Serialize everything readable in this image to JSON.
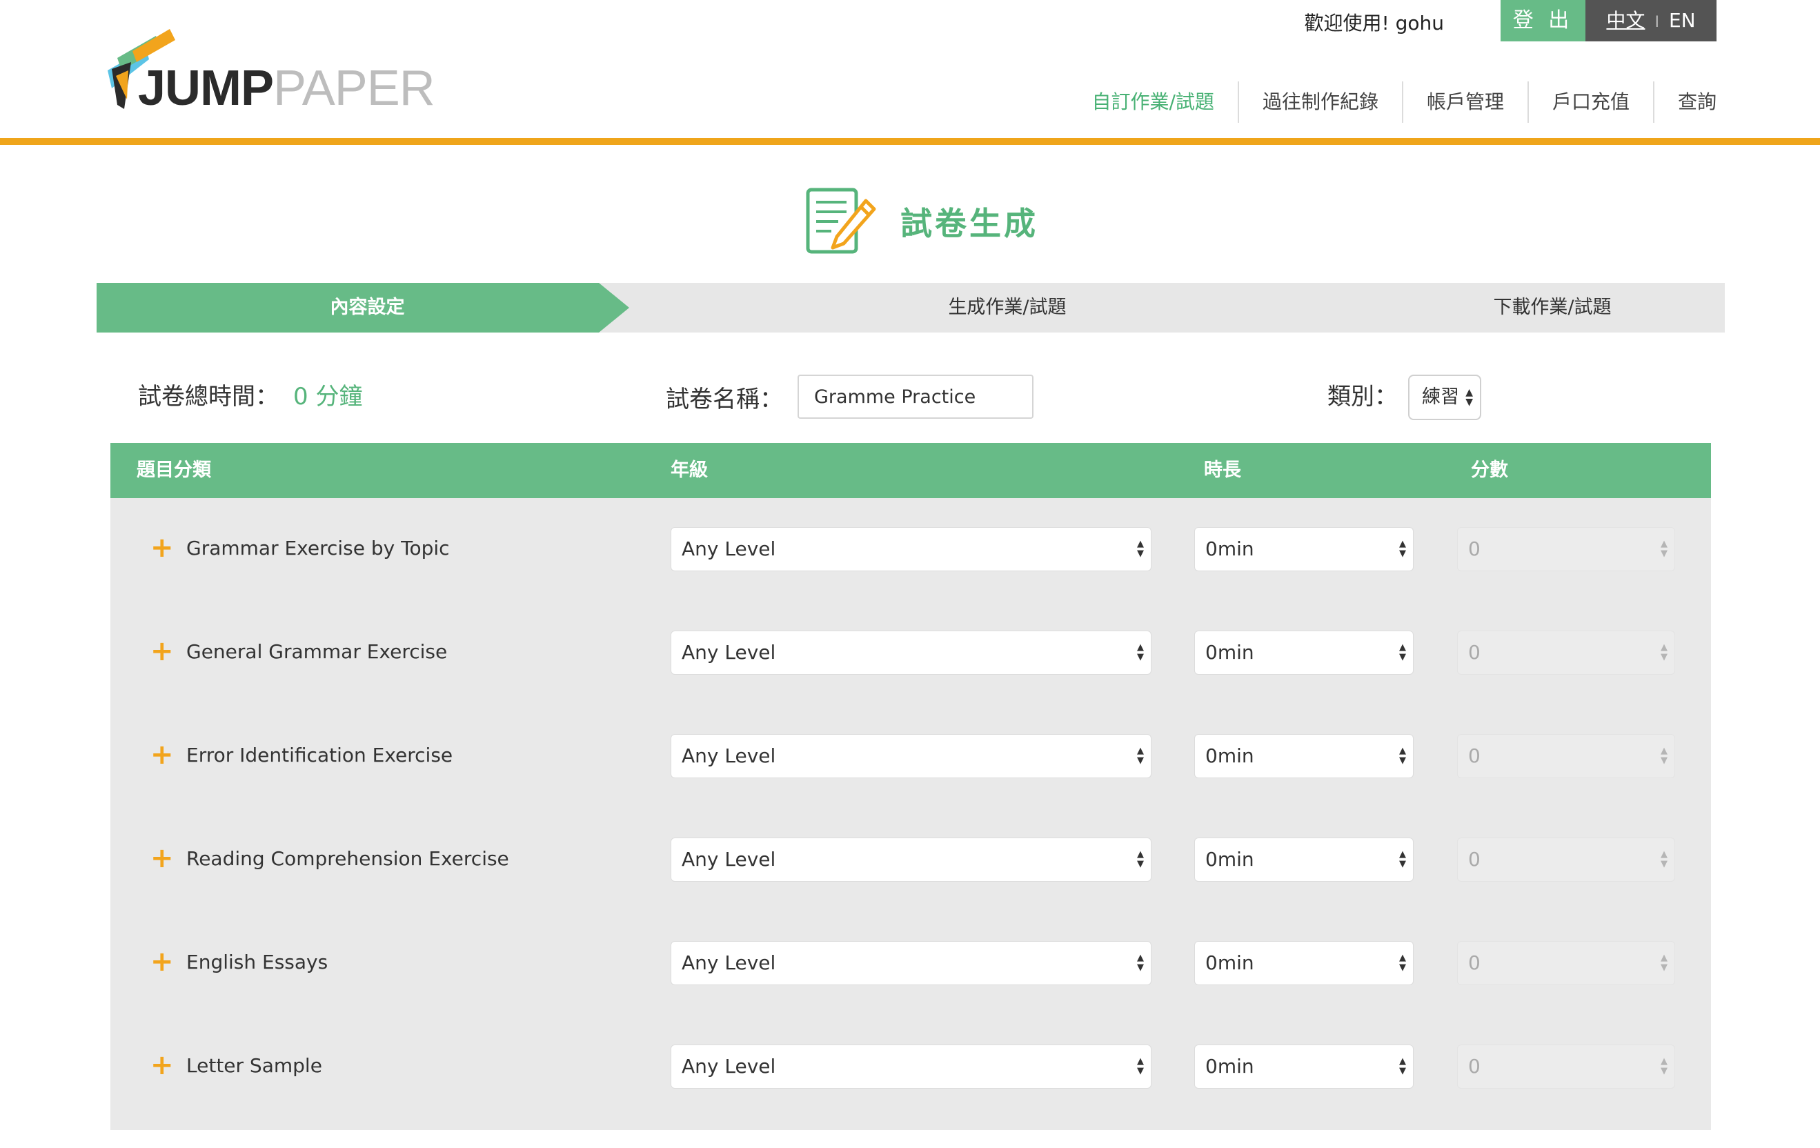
{
  "header": {
    "logo_jump": "JUMP",
    "logo_paper": "PAPER",
    "welcome": "歡迎使用! gohu",
    "logout": "登 出",
    "lang_zh": "中文",
    "lang_sep": "I",
    "lang_en": "EN",
    "nav": [
      {
        "label": "自訂作業/試題",
        "active": true
      },
      {
        "label": "過往制作紀錄"
      },
      {
        "label": "帳戶管理"
      },
      {
        "label": "戶口充值"
      },
      {
        "label": "查詢"
      }
    ]
  },
  "title": "試卷生成",
  "steps": [
    "內容設定",
    "生成作業/試題",
    "下載作業/試題"
  ],
  "settings": {
    "total_label": "試卷總時間：",
    "total_value": "0 分鐘",
    "name_label": "試卷名稱：",
    "name_value": "Gramme Practice",
    "type_label": "類別：",
    "type_value": "練習"
  },
  "table": {
    "headers": [
      "題目分類",
      "年級",
      "時長",
      "分數"
    ],
    "rows": [
      {
        "category": "Grammar Exercise by Topic",
        "level": "Any Level",
        "duration": "0min",
        "score": "0"
      },
      {
        "category": "General Grammar Exercise",
        "level": "Any Level",
        "duration": "0min",
        "score": "0"
      },
      {
        "category": "Error Identification Exercise",
        "level": "Any Level",
        "duration": "0min",
        "score": "0"
      },
      {
        "category": "Reading Comprehension Exercise",
        "level": "Any Level",
        "duration": "0min",
        "score": "0"
      },
      {
        "category": "English Essays",
        "level": "Any Level",
        "duration": "0min",
        "score": "0"
      },
      {
        "category": "Letter Sample",
        "level": "Any Level",
        "duration": "0min",
        "score": "0"
      }
    ]
  },
  "icons": {
    "expand": "plus-icon",
    "select_arrow": "updown-arrow-icon",
    "title": "exam-pencil-icon"
  },
  "colors": {
    "green": "#67bb87",
    "orange": "#efa51b",
    "dark": "#545454"
  }
}
